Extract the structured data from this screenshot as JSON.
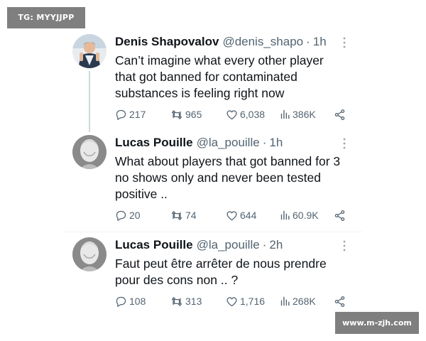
{
  "watermarks": {
    "top_left": "TG: MYYJJPP",
    "bottom_right": "www.m-zjh.com"
  },
  "icons": [
    "reply-icon",
    "retweet-icon",
    "like-icon",
    "views-icon",
    "share-icon",
    "more-icon"
  ],
  "colors": {
    "text": "#0f1419",
    "secondary": "#536471",
    "thread_line": "#cfd9de",
    "watermark_bg": "#7f7f7f"
  },
  "tweets": [
    {
      "name": "Denis Shapovalov",
      "handle": "@denis_shapo",
      "time": "1h",
      "text": "Can’t imagine what every other player\nthat got banned for contaminated\nsubstances is feeling right now",
      "replies": "217",
      "retweets": "965",
      "likes": "6,038",
      "views": "386K"
    },
    {
      "name": "Lucas Pouille",
      "handle": "@la_pouille",
      "time": "1h",
      "text": "What about players that got banned for 3\nno shows only and never been tested\npositive ..",
      "replies": "20",
      "retweets": "74",
      "likes": "644",
      "views": "60.9K"
    },
    {
      "name": "Lucas Pouille",
      "handle": "@la_pouille",
      "time": "2h",
      "text": "Faut peut être arrêter de nous prendre\npour des cons non .. ?",
      "replies": "108",
      "retweets": "313",
      "likes": "1,716",
      "views": "268K"
    }
  ]
}
